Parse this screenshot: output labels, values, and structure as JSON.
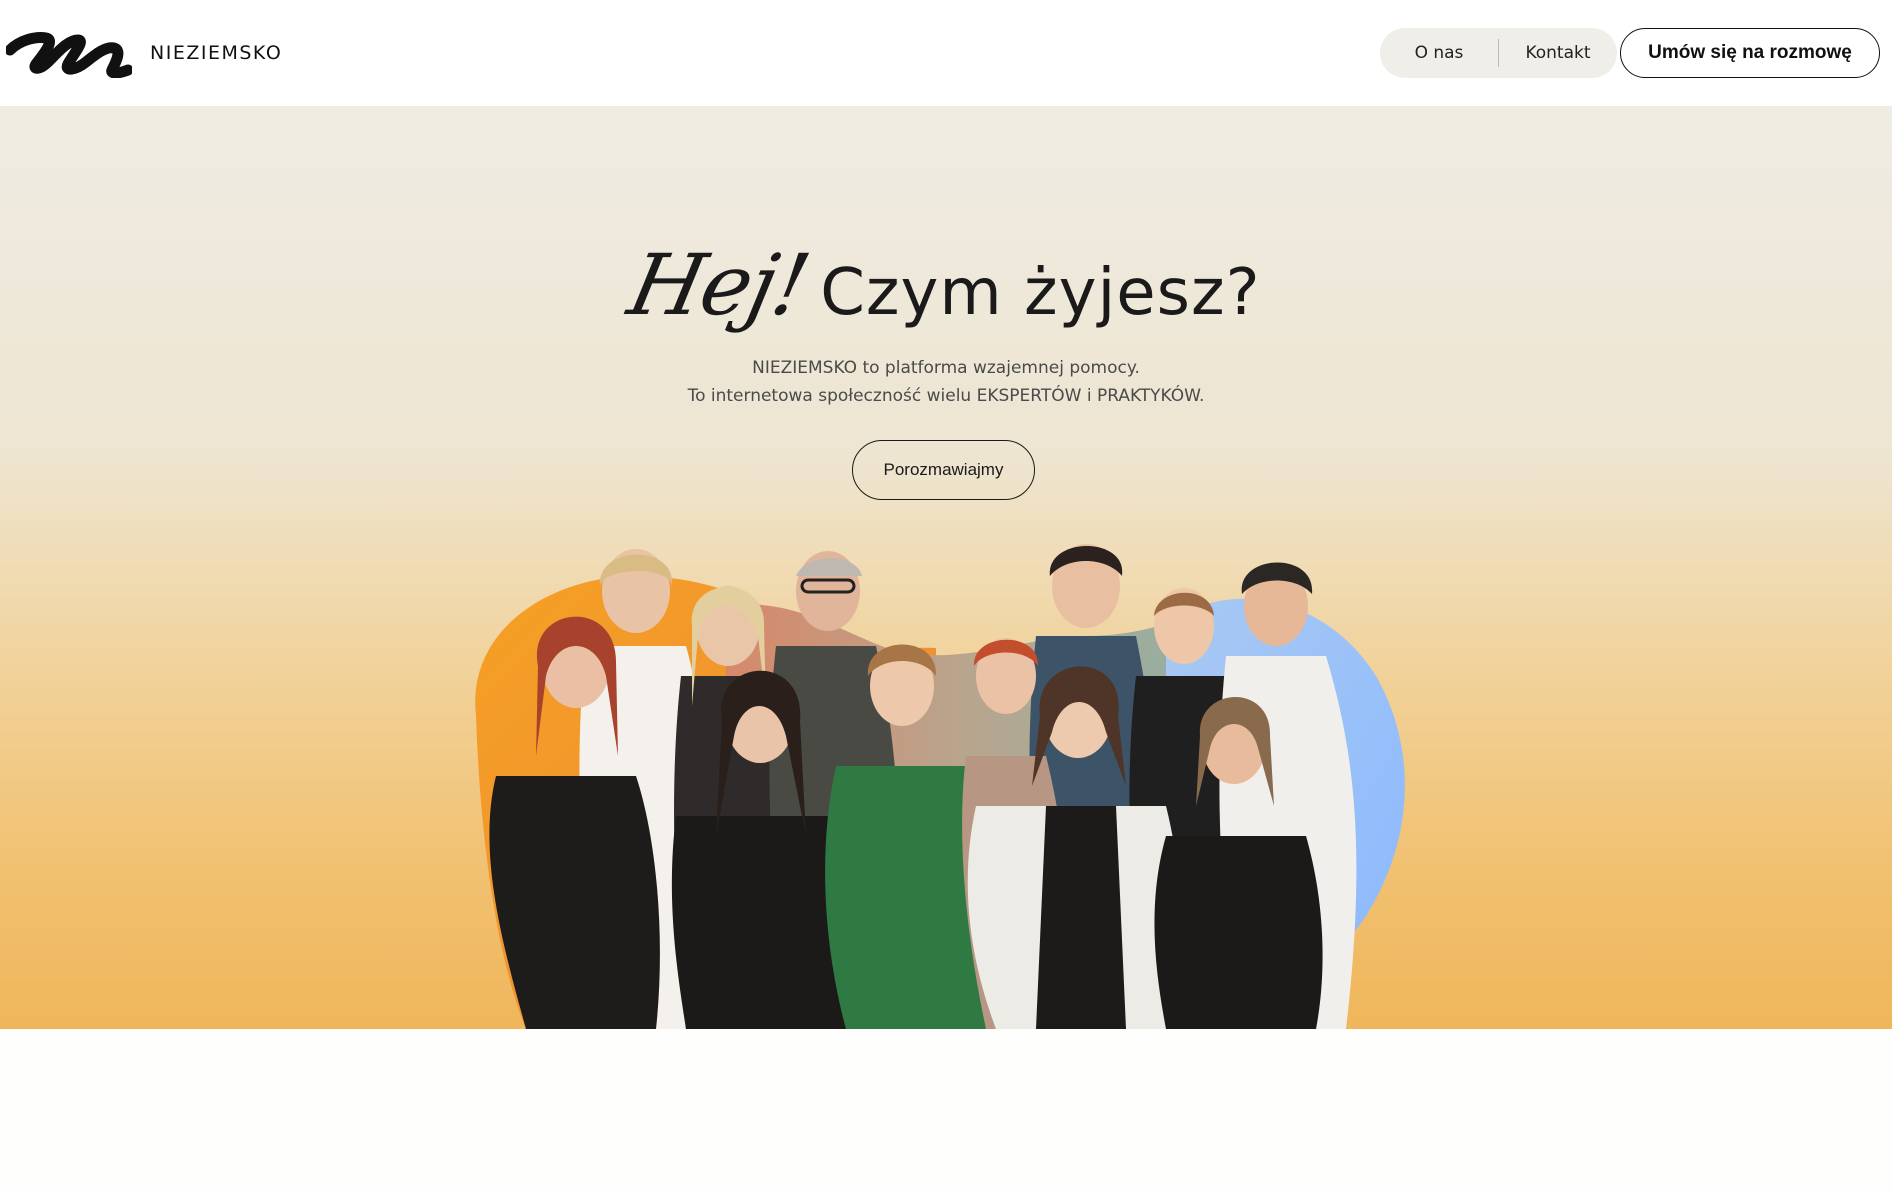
{
  "brand": {
    "name": "NIEZIEMSKO"
  },
  "nav": {
    "about_label": "O nas",
    "contact_label": "Kontakt",
    "cta_label": "Umów się na rozmowę"
  },
  "hero": {
    "headline_script": "Hej!",
    "headline_main": "Czym żyjesz?",
    "subtitle_line1": "NIEZIEMSKO to platforma wzajemnej pomocy.",
    "subtitle_line2": "To internetowa społeczność wielu EKSPERTÓW i PRAKTYKÓW.",
    "cta_label": "Porozmawiajmy"
  },
  "colors": {
    "accent_orange": "#f39b1c",
    "accent_blue": "#9ec7ff",
    "accent_sage": "#a9b9a0",
    "hero_top": "#efece3",
    "hero_bottom": "#f0b65b",
    "nav_pill": "#efeee9"
  }
}
